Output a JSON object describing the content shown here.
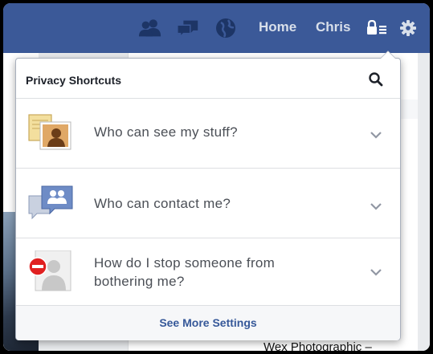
{
  "topbar": {
    "home_label": "Home",
    "profile_label": "Chris",
    "icons": [
      "friend-requests-icon",
      "messages-icon",
      "notifications-globe-icon",
      "privacy-shortcuts-icon",
      "settings-gear-icon"
    ]
  },
  "background": {
    "bottom_text": "Wex Photographic –"
  },
  "popover": {
    "title": "Privacy Shortcuts",
    "items": [
      {
        "label": "Who can see my stuff?",
        "icon": "photos-silhouette-icon"
      },
      {
        "label": "Who can contact me?",
        "icon": "contact-bubbles-icon"
      },
      {
        "label_line1": "How do I stop someone from",
        "label_line2": "bothering me?",
        "icon": "block-user-icon"
      }
    ],
    "footer_link": "See More Settings"
  },
  "colors": {
    "topbar": "#3b5998",
    "link": "#365899",
    "row_text": "#4b4f56",
    "chevron": "#9197a3",
    "block_red": "#e02020"
  }
}
